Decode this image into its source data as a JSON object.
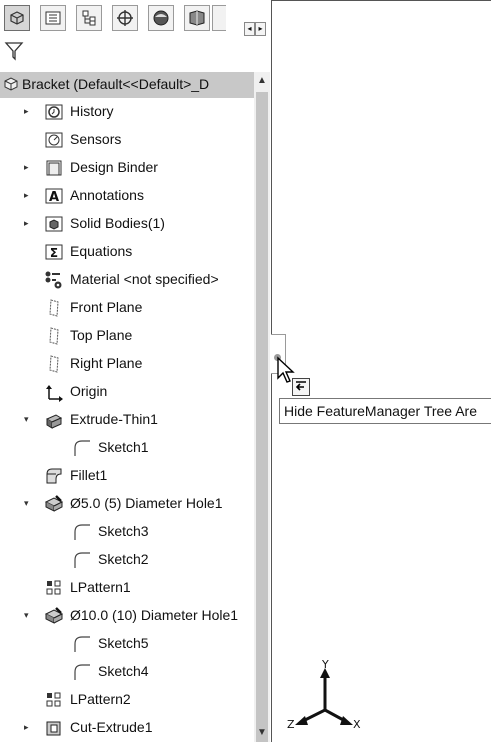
{
  "toolbar": {
    "tabs": [
      {
        "icon": "feature-manager-icon"
      },
      {
        "icon": "property-manager-icon"
      },
      {
        "icon": "configuration-manager-icon"
      },
      {
        "icon": "dimxpert-manager-icon"
      },
      {
        "icon": "display-manager-icon"
      },
      {
        "icon": "cam-manager-icon"
      }
    ],
    "scroll_left": "◂",
    "scroll_right": "▸"
  },
  "filter": {
    "icon": "filter-icon"
  },
  "tree": {
    "root_label": "Bracket  (Default<<Default>_D",
    "items": [
      {
        "label": "History",
        "expandable": true
      },
      {
        "label": "Sensors",
        "expandable": false
      },
      {
        "label": "Design Binder",
        "expandable": true
      },
      {
        "label": "Annotations",
        "expandable": true
      },
      {
        "label": "Solid Bodies(1)",
        "expandable": true
      },
      {
        "label": "Equations",
        "expandable": false
      },
      {
        "label": "Material <not specified>",
        "expandable": false
      },
      {
        "label": "Front Plane",
        "expandable": false
      },
      {
        "label": "Top Plane",
        "expandable": false
      },
      {
        "label": "Right Plane",
        "expandable": false
      },
      {
        "label": "Origin",
        "expandable": false
      },
      {
        "label": "Extrude-Thin1",
        "expandable": true,
        "expanded": true
      },
      {
        "label": "Sketch1",
        "expandable": false
      },
      {
        "label": "Fillet1",
        "expandable": false
      },
      {
        "label": "Ø5.0 (5) Diameter Hole1",
        "expandable": true,
        "expanded": true
      },
      {
        "label": "Sketch3",
        "expandable": false
      },
      {
        "label": "Sketch2",
        "expandable": false
      },
      {
        "label": "LPattern1",
        "expandable": false
      },
      {
        "label": "Ø10.0 (10) Diameter Hole1",
        "expandable": true,
        "expanded": true
      },
      {
        "label": "Sketch5",
        "expandable": false
      },
      {
        "label": "Sketch4",
        "expandable": false
      },
      {
        "label": "LPattern2",
        "expandable": false
      },
      {
        "label": "Cut-Extrude1",
        "expandable": true
      }
    ]
  },
  "tooltip": {
    "text": "Hide FeatureManager Tree Are"
  },
  "triad": {
    "x": "X",
    "y": "Y",
    "z": "Z"
  },
  "colors": {
    "selection": "#c8c8c8",
    "scroll_thumb": "#c4c4c4"
  }
}
